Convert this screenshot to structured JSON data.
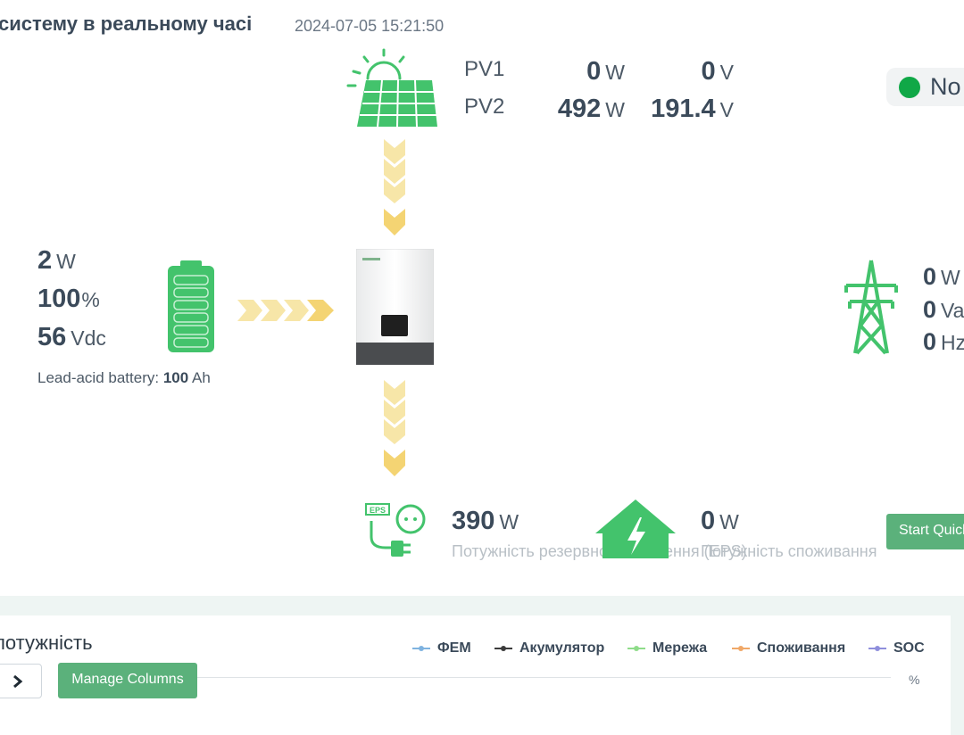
{
  "header": {
    "title": "систему в реальному часі",
    "datetime": "2024-07-05 15:21:50"
  },
  "pv": {
    "rows": [
      {
        "label": "PV1",
        "power": "0",
        "power_unit": "W",
        "voltage": "0",
        "voltage_unit": "V"
      },
      {
        "label": "PV2",
        "power": "492",
        "power_unit": "W",
        "voltage": "191.4",
        "voltage_unit": "V"
      }
    ]
  },
  "status": {
    "text": "No",
    "color": "#10a847"
  },
  "battery": {
    "power": "2",
    "power_unit": "W",
    "soc": "100",
    "soc_unit": "%",
    "voltage": "56",
    "voltage_unit": "Vdc",
    "type_label": "Lead-acid battery:",
    "capacity": "100",
    "capacity_unit": "Ah"
  },
  "grid": {
    "power": "0",
    "power_unit": "W",
    "voltage": "0",
    "voltage_unit": "Va",
    "frequency": "0",
    "frequency_unit": "Hz"
  },
  "eps": {
    "power": "390",
    "power_unit": "W",
    "label": "Потужність резервного живлення (EPS)",
    "badge": "EPS"
  },
  "consumption": {
    "power": "0",
    "power_unit": "W",
    "label": "Потужність споживання"
  },
  "buttons": {
    "start_quick": "Start Quick",
    "manage_columns": "Manage Columns"
  },
  "chart": {
    "title": "потужність",
    "y_unit": "%",
    "legend": [
      {
        "name": "ФЕМ",
        "color": "#7fb3e0"
      },
      {
        "name": "Акумулятор",
        "color": "#3b3b3b"
      },
      {
        "name": "Мережа",
        "color": "#8fdc8a"
      },
      {
        "name": "Споживання",
        "color": "#f0a868"
      },
      {
        "name": "SOC",
        "color": "#8f8fdc"
      }
    ]
  },
  "colors": {
    "accent_green": "#5bb17b",
    "icon_green": "#3cbf6a",
    "arrow_yellow": "#f7e6a8"
  }
}
